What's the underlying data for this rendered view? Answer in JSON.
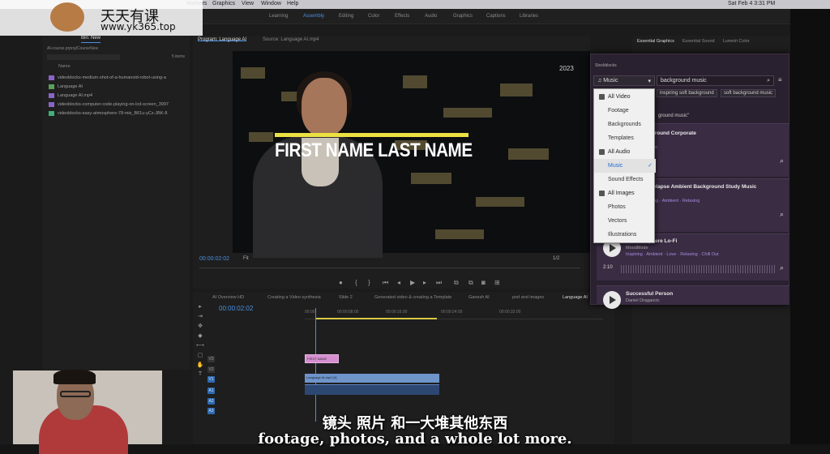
{
  "menubar": {
    "items": [
      "Markers",
      "Graphics",
      "View",
      "Window",
      "Help"
    ],
    "datetime": "Sat Feb 4  3:31 PM"
  },
  "workspaces": {
    "items": [
      "Learning",
      "Assembly",
      "Editing",
      "Color",
      "Effects",
      "Audio",
      "Graphics",
      "Captions",
      "Libraries"
    ],
    "active": "Assembly"
  },
  "project": {
    "tabs": [
      "Bin: New"
    ],
    "path": "AI-course.prproj/CourseNew",
    "count": "5 items",
    "column_name": "Name",
    "files": [
      {
        "name": "videoblocks-medium-shot-of-a-humanoid-robot-using-a",
        "color": "#8a64c8"
      },
      {
        "name": "Language AI",
        "color": "#5aa05a"
      },
      {
        "name": "Language AI.mp4",
        "color": "#8a64c8"
      },
      {
        "name": "videoblocks-computer-code-playing-on-lcd-screen_3997",
        "color": "#8a64c8"
      },
      {
        "name": "videoblocks-easy-atmosphere-78-mix_B61u-yCz-JBK-8",
        "color": "#3fb07a"
      }
    ]
  },
  "monitor": {
    "tab_program": "Program: Language AI",
    "tab_source": "Source: Language AI.mp4",
    "lower_third": "FIRST NAME LAST NAME",
    "year": "2023",
    "timecode": "00:00:02:02",
    "fit": "Fit",
    "zoom": "1/2"
  },
  "timeline": {
    "tabs": [
      "Creating a Video synthesia",
      "Slide 2",
      "Generated video & creating a Template",
      "Ganesh AI",
      "pod and images",
      "Language AI"
    ],
    "first_tab": "AI Overview HD",
    "timecode": "00:00:02:02",
    "ruler": [
      "00:00",
      "00:00:08:00",
      "00:00:16:00",
      "00:00:24:00",
      "00:00:32:00"
    ],
    "tracks": [
      "V3",
      "V2",
      "V1",
      "A1",
      "A2",
      "A3"
    ],
    "clip_title": "FIRST NAME",
    "clip_v1": "Language AI.mp4 [V]"
  },
  "right_panel": {
    "tabs": [
      "Essential Graphics",
      "Essential Sound",
      "Lumetri Color"
    ],
    "stock_title": "Stockblocks",
    "category_selected": "Music",
    "search_value": "background music",
    "chips": [
      "inspiring soft background",
      "soft background music"
    ],
    "results_prefix": "ground music\"",
    "dropdown": [
      {
        "label": "All Video",
        "head": true
      },
      {
        "label": "Footage"
      },
      {
        "label": "Backgrounds"
      },
      {
        "label": "Templates"
      },
      {
        "label": "All Audio",
        "head": true
      },
      {
        "label": "Music",
        "selected": true
      },
      {
        "label": "Sound Effects"
      },
      {
        "label": "All Images",
        "head": true
      },
      {
        "label": "Photos"
      },
      {
        "label": "Vectors"
      },
      {
        "label": "Illustrations"
      }
    ],
    "results": [
      {
        "title": "kground Corporate",
        "tags": "e"
      },
      {
        "title": "melapse Ambient Background Study Music",
        "tags": "pring  ·  Ambient  ·  Relaxing"
      },
      {
        "title": "phere Lo-Fi",
        "author": "MoodMode",
        "tags": "Inspiring  ·  Ambient  ·  Love  ·  Relaxing  ·  Chill Out",
        "duration": "2:10"
      },
      {
        "title": "Successful Person",
        "author": "Daniel Dragancic"
      }
    ]
  },
  "watermark": {
    "title": "天天有课",
    "url": "www.yk365.top"
  },
  "subtitles": {
    "cn": "镜头 照片 和一大堆其他东西",
    "en": "footage, photos, and a whole lot more."
  }
}
